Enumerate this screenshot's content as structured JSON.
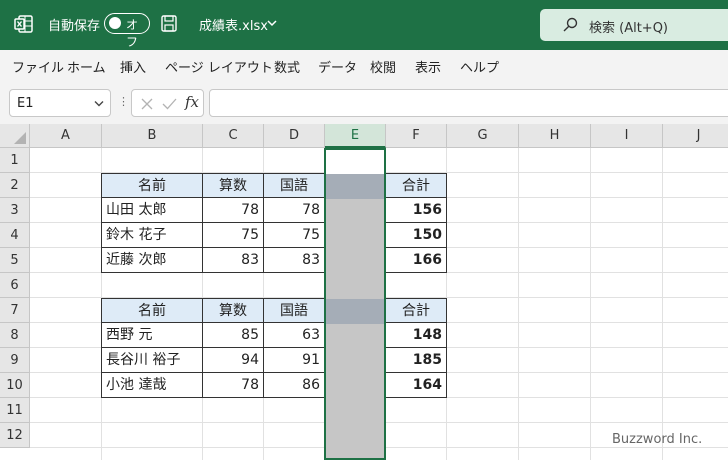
{
  "titlebar": {
    "autosave_label": "自動保存",
    "autosave_state": "オフ",
    "filename": "成績表.xlsx",
    "search_placeholder": "検索 (Alt+Q)",
    "accent_color": "#1e7145"
  },
  "menu": [
    "ファイル",
    "ホーム",
    "挿入",
    "ページ レイアウト",
    "数式",
    "データ",
    "校閲",
    "表示",
    "ヘルプ"
  ],
  "formula_bar": {
    "name_box": "E1",
    "formula": ""
  },
  "columns": [
    "A",
    "B",
    "C",
    "D",
    "E",
    "F",
    "G",
    "H",
    "I",
    "J"
  ],
  "rows": [
    "1",
    "2",
    "3",
    "4",
    "5",
    "6",
    "7",
    "8",
    "9",
    "10",
    "11",
    "12"
  ],
  "selected_column": "E",
  "tables": [
    {
      "headers": [
        "名前",
        "算数",
        "国語",
        "",
        "合計"
      ],
      "rows": [
        [
          "山田 太郎",
          "78",
          "78",
          "",
          "156"
        ],
        [
          "鈴木 花子",
          "75",
          "75",
          "",
          "150"
        ],
        [
          "近藤 次郎",
          "83",
          "83",
          "",
          "166"
        ]
      ]
    },
    {
      "headers": [
        "名前",
        "算数",
        "国語",
        "",
        "合計"
      ],
      "rows": [
        [
          "西野 元",
          "85",
          "63",
          "",
          "148"
        ],
        [
          "長谷川 裕子",
          "94",
          "91",
          "",
          "185"
        ],
        [
          "小池 達哉",
          "78",
          "86",
          "",
          "164"
        ]
      ]
    }
  ],
  "watermark": "Buzzword Inc."
}
